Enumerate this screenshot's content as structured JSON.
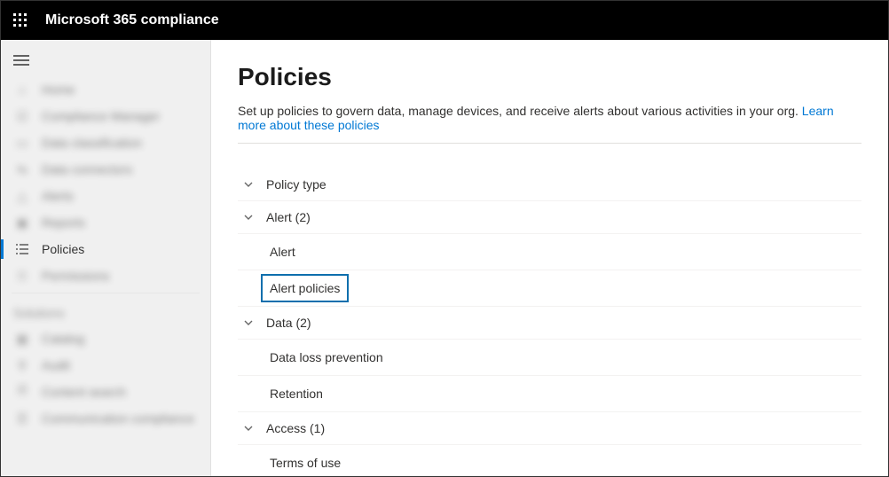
{
  "header": {
    "brand": "Microsoft 365 compliance"
  },
  "sidebar": {
    "items": [
      {
        "label": "Home"
      },
      {
        "label": "Compliance Manager"
      },
      {
        "label": "Data classification"
      },
      {
        "label": "Data connectors"
      },
      {
        "label": "Alerts"
      },
      {
        "label": "Reports"
      },
      {
        "label": "Policies"
      },
      {
        "label": "Permissions"
      }
    ],
    "section_label": "Solutions",
    "solutions": [
      {
        "label": "Catalog"
      },
      {
        "label": "Audit"
      },
      {
        "label": "Content search"
      },
      {
        "label": "Communication compliance"
      }
    ]
  },
  "main": {
    "title": "Policies",
    "description": "Set up policies to govern data, manage devices, and receive alerts about various activities in your org. ",
    "learn_more": "Learn more about these policies",
    "type_header": "Policy type",
    "groups": [
      {
        "label": "Alert (2)",
        "items": [
          "Alert",
          "Alert policies"
        ]
      },
      {
        "label": "Data (2)",
        "items": [
          "Data loss prevention",
          "Retention"
        ]
      },
      {
        "label": "Access (1)",
        "items": [
          "Terms of use"
        ]
      }
    ]
  }
}
